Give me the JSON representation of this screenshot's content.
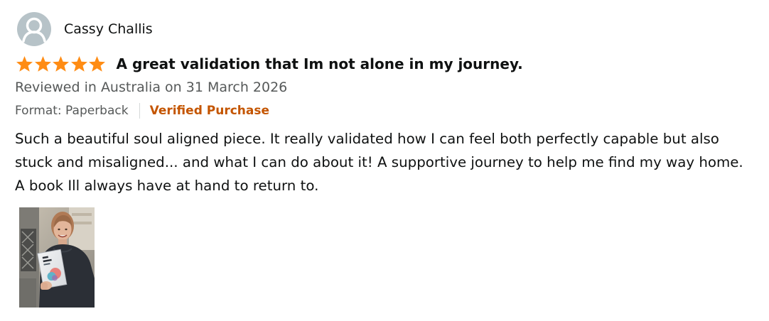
{
  "reviewer": {
    "name": "Cassy Challis",
    "avatar_icon": "default-profile-avatar-icon"
  },
  "rating": {
    "stars": 5,
    "max": 5,
    "star_color": "#ff8c14",
    "icon": "star-icon"
  },
  "review": {
    "title": "A great validation that Im not alone in my journey.",
    "date_text": "Reviewed in Australia on 31 March 2026",
    "format_text": "Format: Paperback",
    "verified_text": "Verified Purchase",
    "body_lines": [
      "Such a beautiful soul aligned piece. It really validated how I can feel both perfectly capable but also",
      "stuck and misaligned... and what I can do about it! A supportive journey to help me find my way home.",
      "A book Ill always have at hand to return to."
    ]
  },
  "colors": {
    "text": "#0f1111",
    "secondary_text": "#565959",
    "verified": "#c45500",
    "divider": "#d5d9d9",
    "avatar_bg": "#b7c3c8"
  },
  "media": {
    "photo_icon": "customer-photo-thumbnail"
  }
}
